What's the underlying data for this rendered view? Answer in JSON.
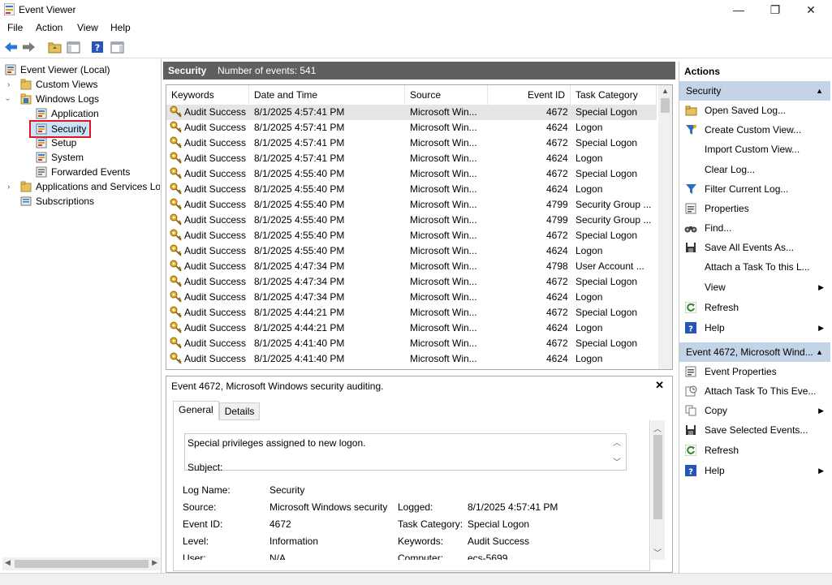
{
  "window": {
    "title": "Event Viewer",
    "minimize": "—",
    "maximize": "❐",
    "close": "✕"
  },
  "menu": [
    "File",
    "Action",
    "View",
    "Help"
  ],
  "tree": {
    "root": "Event Viewer (Local)",
    "custom_views": "Custom Views",
    "windows_logs": "Windows Logs",
    "application": "Application",
    "security": "Security",
    "setup": "Setup",
    "system": "System",
    "forwarded": "Forwarded Events",
    "apps_services": "Applications and Services Lo",
    "subscriptions": "Subscriptions"
  },
  "log_header": {
    "name": "Security",
    "count": "Number of events: 541"
  },
  "columns": {
    "keywords": "Keywords",
    "date": "Date and Time",
    "source": "Source",
    "event_id": "Event ID",
    "task": "Task Category"
  },
  "events": [
    {
      "kw": "Audit Success",
      "date": "8/1/2025 4:57:41 PM",
      "src": "Microsoft Win...",
      "id": "4672",
      "task": "Special Logon"
    },
    {
      "kw": "Audit Success",
      "date": "8/1/2025 4:57:41 PM",
      "src": "Microsoft Win...",
      "id": "4624",
      "task": "Logon"
    },
    {
      "kw": "Audit Success",
      "date": "8/1/2025 4:57:41 PM",
      "src": "Microsoft Win...",
      "id": "4672",
      "task": "Special Logon"
    },
    {
      "kw": "Audit Success",
      "date": "8/1/2025 4:57:41 PM",
      "src": "Microsoft Win...",
      "id": "4624",
      "task": "Logon"
    },
    {
      "kw": "Audit Success",
      "date": "8/1/2025 4:55:40 PM",
      "src": "Microsoft Win...",
      "id": "4672",
      "task": "Special Logon"
    },
    {
      "kw": "Audit Success",
      "date": "8/1/2025 4:55:40 PM",
      "src": "Microsoft Win...",
      "id": "4624",
      "task": "Logon"
    },
    {
      "kw": "Audit Success",
      "date": "8/1/2025 4:55:40 PM",
      "src": "Microsoft Win...",
      "id": "4799",
      "task": "Security Group ..."
    },
    {
      "kw": "Audit Success",
      "date": "8/1/2025 4:55:40 PM",
      "src": "Microsoft Win...",
      "id": "4799",
      "task": "Security Group ..."
    },
    {
      "kw": "Audit Success",
      "date": "8/1/2025 4:55:40 PM",
      "src": "Microsoft Win...",
      "id": "4672",
      "task": "Special Logon"
    },
    {
      "kw": "Audit Success",
      "date": "8/1/2025 4:55:40 PM",
      "src": "Microsoft Win...",
      "id": "4624",
      "task": "Logon"
    },
    {
      "kw": "Audit Success",
      "date": "8/1/2025 4:47:34 PM",
      "src": "Microsoft Win...",
      "id": "4798",
      "task": "User Account ..."
    },
    {
      "kw": "Audit Success",
      "date": "8/1/2025 4:47:34 PM",
      "src": "Microsoft Win...",
      "id": "4672",
      "task": "Special Logon"
    },
    {
      "kw": "Audit Success",
      "date": "8/1/2025 4:47:34 PM",
      "src": "Microsoft Win...",
      "id": "4624",
      "task": "Logon"
    },
    {
      "kw": "Audit Success",
      "date": "8/1/2025 4:44:21 PM",
      "src": "Microsoft Win...",
      "id": "4672",
      "task": "Special Logon"
    },
    {
      "kw": "Audit Success",
      "date": "8/1/2025 4:44:21 PM",
      "src": "Microsoft Win...",
      "id": "4624",
      "task": "Logon"
    },
    {
      "kw": "Audit Success",
      "date": "8/1/2025 4:41:40 PM",
      "src": "Microsoft Win...",
      "id": "4672",
      "task": "Special Logon"
    },
    {
      "kw": "Audit Success",
      "date": "8/1/2025 4:41:40 PM",
      "src": "Microsoft Win...",
      "id": "4624",
      "task": "Logon"
    }
  ],
  "detail": {
    "title": "Event 4672, Microsoft Windows security auditing.",
    "tab_general": "General",
    "tab_details": "Details",
    "desc_line1": "Special privileges assigned to new logon.",
    "desc_line2": "Subject:",
    "log_name_label": "Log Name:",
    "log_name": "Security",
    "source_label": "Source:",
    "source": "Microsoft Windows security",
    "logged_label": "Logged:",
    "logged": "8/1/2025 4:57:41 PM",
    "event_id_label": "Event ID:",
    "event_id": "4672",
    "task_label": "Task Category:",
    "task": "Special Logon",
    "level_label": "Level:",
    "level": "Information",
    "keywords_label": "Keywords:",
    "keywords": "Audit Success",
    "user_label": "User:",
    "user": "N/A",
    "computer_label": "Computer:",
    "computer": "ecs-5699"
  },
  "actions": {
    "title": "Actions",
    "section1": "Security",
    "open_saved": "Open Saved Log...",
    "create_custom": "Create Custom View...",
    "import_custom": "Import Custom View...",
    "clear_log": "Clear Log...",
    "filter": "Filter Current Log...",
    "properties": "Properties",
    "find": "Find...",
    "save_all": "Save All Events As...",
    "attach_task_log": "Attach a Task To this L...",
    "view": "View",
    "refresh": "Refresh",
    "help": "Help",
    "section2": "Event 4672, Microsoft Wind...",
    "event_properties": "Event Properties",
    "attach_task_event": "Attach Task To This Eve...",
    "copy": "Copy",
    "save_selected": "Save Selected Events...",
    "refresh2": "Refresh",
    "help2": "Help"
  },
  "colors": {
    "header_bg": "#5f5f5f",
    "section_bg": "#c4d4e8",
    "selection_border": "#e81123",
    "accent": "#2b78d0"
  }
}
